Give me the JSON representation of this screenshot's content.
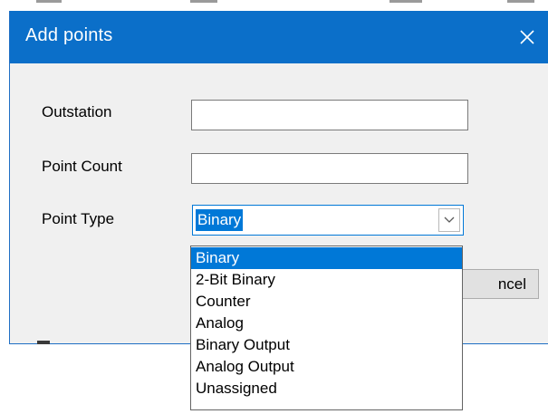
{
  "dialog": {
    "title": "Add points",
    "close_icon": "close-icon",
    "fields": {
      "outstation_label": "Outstation",
      "outstation_value": "",
      "point_count_label": "Point Count",
      "point_count_value": "",
      "point_type_label": "Point Type",
      "point_type_value": "Binary"
    },
    "cancel_label": "ncel"
  },
  "dropdown": {
    "options": [
      "Binary",
      "2-Bit Binary",
      "Counter",
      "Analog",
      "Binary Output",
      "Analog Output",
      "Unassigned"
    ],
    "selected_index": 0,
    "arrow_icon": "chevron-down-icon"
  },
  "colors": {
    "titlebar": "#0b6fc9",
    "selection": "#0078d7",
    "dialog_bg": "#f0f0f0"
  }
}
